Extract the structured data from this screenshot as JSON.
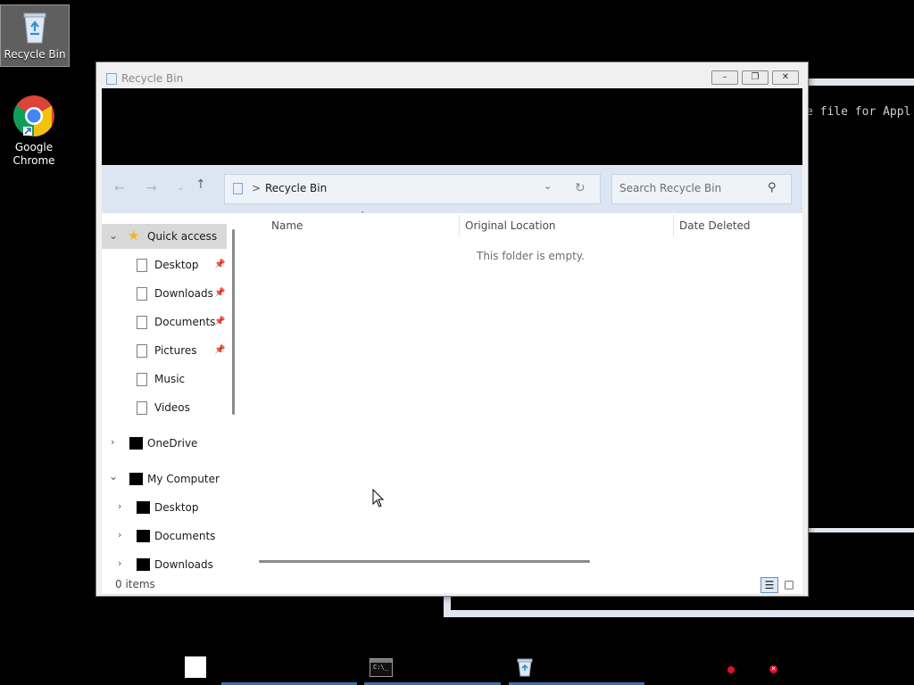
{
  "desktop": {
    "icons": [
      {
        "label": "Recycle Bin",
        "icon": "recycle-bin-icon"
      },
      {
        "label": "Google Chrome",
        "icon": "chrome-icon"
      }
    ]
  },
  "console": {
    "visible_text": "e file for Appl"
  },
  "window": {
    "title": "Recycle Bin",
    "buttons": {
      "minimize": "minimize",
      "maximize": "maximize",
      "close": "close"
    },
    "address": {
      "separator": ">",
      "location": "Recycle Bin"
    },
    "search": {
      "placeholder": "Search Recycle Bin"
    },
    "sidebar": {
      "quick_access": "Quick access",
      "pinned": [
        {
          "label": "Desktop",
          "pinned": true
        },
        {
          "label": "Downloads",
          "pinned": true
        },
        {
          "label": "Documents",
          "pinned": true
        },
        {
          "label": "Pictures",
          "pinned": true
        },
        {
          "label": "Music",
          "pinned": false
        },
        {
          "label": "Videos",
          "pinned": false
        }
      ],
      "onedrive": "OneDrive",
      "my_computer": "My Computer",
      "computer_children": [
        "Desktop",
        "Documents",
        "Downloads"
      ]
    },
    "columns": [
      "Name",
      "Original Location",
      "Date Deleted"
    ],
    "empty_message": "This folder is empty.",
    "status": "0 items"
  },
  "colors": {
    "desktop_bg": "#000000",
    "navbar_bg": "#dce6f2",
    "taskbar_indicator": "#3c6fb4",
    "tray_red": "#e0102a"
  }
}
